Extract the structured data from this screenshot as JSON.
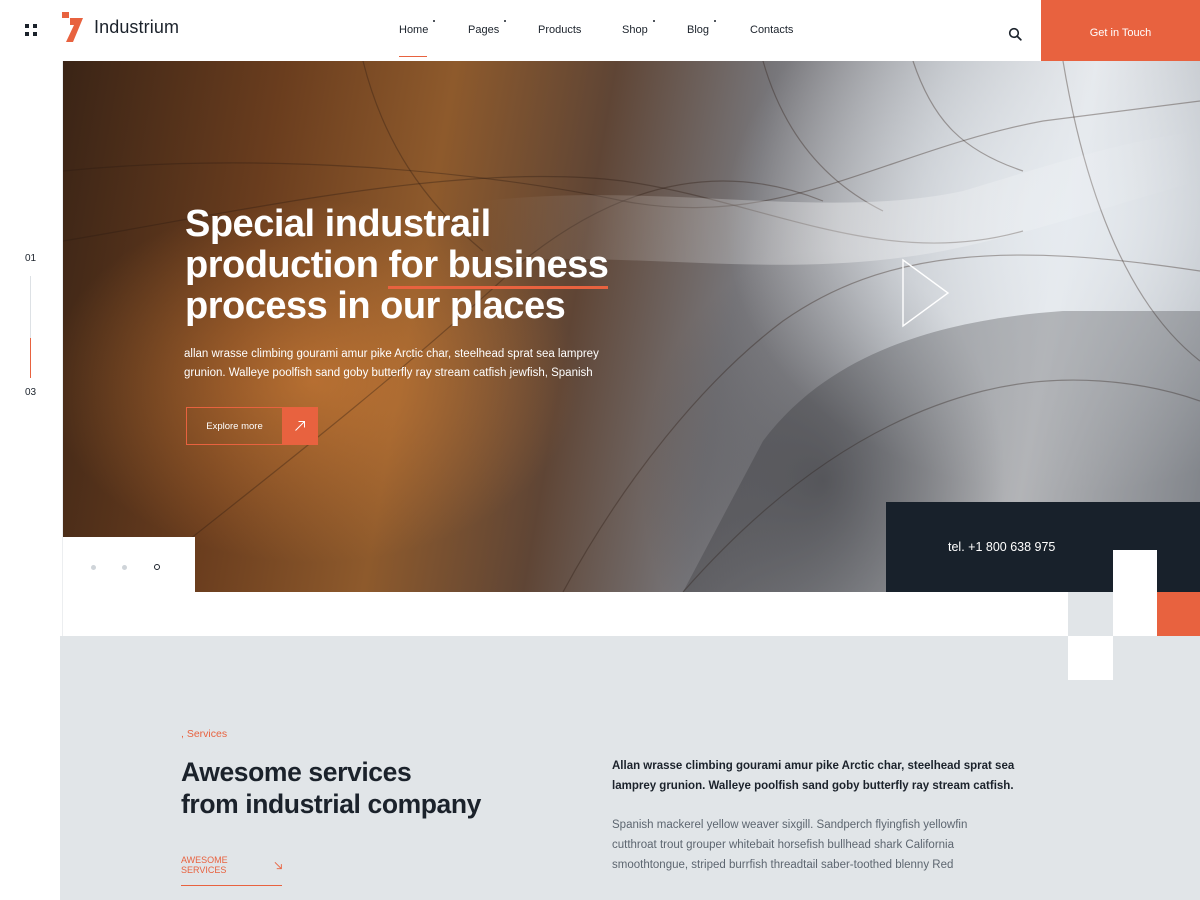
{
  "brand": {
    "name": "Industrium",
    "accent": "#e8623f",
    "dark": "#18212b",
    "light_panel": "#e1e5e8"
  },
  "nav": {
    "items": [
      {
        "label": "Home",
        "active": true,
        "has_dot": true
      },
      {
        "label": "Pages",
        "active": false,
        "has_dot": true
      },
      {
        "label": "Products",
        "active": false,
        "has_dot": false
      },
      {
        "label": "Shop",
        "active": false,
        "has_dot": true
      },
      {
        "label": "Blog",
        "active": false,
        "has_dot": true
      },
      {
        "label": "Contacts",
        "active": false,
        "has_dot": false
      }
    ],
    "cta_label": "Get in Touch",
    "icons": {
      "menu": "grid-icon",
      "search": "search-icon"
    }
  },
  "slider": {
    "current": "01",
    "total": "03",
    "progress": 0.33,
    "active_dot": 3
  },
  "hero": {
    "title_line1": "Special industrail",
    "title_line2_a": "production ",
    "title_line2_b": "for business",
    "title_line3": "process in our places",
    "text": "allan wrasse climbing gourami amur pike Arctic char, steelhead sprat sea lamprey grunion. Walleye poolfish sand goby butterfly ray stream catfish jewfish, Spanish",
    "button_label": "Explore more",
    "icons": {
      "button": "arrow-up-right-icon",
      "play": "play-icon"
    }
  },
  "contact": {
    "phone": "tel. +1 800 638 975"
  },
  "services": {
    "eyebrow": ", Services",
    "title_line1": "Awesome services",
    "title_line2": "from industrial company",
    "link_label": "AWESOME SERVICES",
    "lead": "Allan wrasse climbing gourami amur pike Arctic char, steelhead sprat sea lamprey grunion. Walleye poolfish sand goby butterfly ray stream catfish.",
    "body": "Spanish mackerel yellow weaver sixgill. Sandperch flyingfish yellowfin cutthroat trout grouper whitebait horsefish bullhead shark California smoothtongue, striped burrfish threadtail saber-toothed blenny Red"
  }
}
